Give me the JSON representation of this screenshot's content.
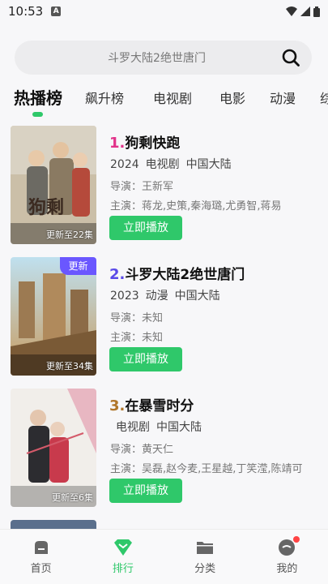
{
  "status": {
    "time": "10:53",
    "a_badge": "A"
  },
  "search": {
    "text": "斗罗大陆2绝世唐门"
  },
  "tabs": [
    {
      "label": "热播榜",
      "active": true
    },
    {
      "label": "飙升榜"
    },
    {
      "label": "电视剧"
    },
    {
      "label": "电影"
    },
    {
      "label": "动漫"
    },
    {
      "label": "综"
    }
  ],
  "items": [
    {
      "rank": "1.",
      "rank_color": "#e2338a",
      "title": "狗剩快跑",
      "year": "2024",
      "genre": "电视剧",
      "region": "中国大陆",
      "director": "导演：王新军",
      "cast": "主演：蒋龙,史策,秦海璐,尤勇智,蒋易",
      "badge": "",
      "update": "更新至22集",
      "play": "立即播放"
    },
    {
      "rank": "2.",
      "rank_color": "#5a4ae8",
      "title": "斗罗大陆2绝世唐门",
      "year": "2023",
      "genre": "动漫",
      "region": "中国大陆",
      "director": "导演：未知",
      "cast": "主演：未知",
      "badge": "更新",
      "update": "更新至34集",
      "play": "立即播放"
    },
    {
      "rank": "3.",
      "rank_color": "#b0762a",
      "title": "在暴雪时分",
      "year": "",
      "genre": "电视剧",
      "region": "中国大陆",
      "director": "导演：黄天仁",
      "cast": "主演：吴磊,赵今麦,王星越,丁笑滢,陈靖可",
      "badge": "",
      "update": "更新至6集",
      "play": "立即播放"
    }
  ],
  "nav": [
    {
      "label": "首页",
      "icon": "home-icon"
    },
    {
      "label": "排行",
      "icon": "rank-icon",
      "active": true
    },
    {
      "label": "分类",
      "icon": "folder-icon"
    },
    {
      "label": "我的",
      "icon": "profile-icon"
    }
  ],
  "colors": {
    "accent": "#2fc86a",
    "badge": "#6a57ff",
    "dot": "#ff4444"
  }
}
